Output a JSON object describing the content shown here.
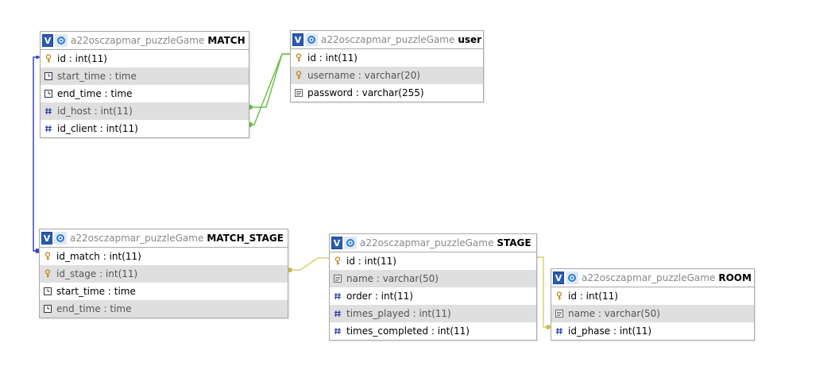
{
  "colors": {
    "header_toggle": "#2a5caa",
    "alt_row": "#dfdfdf",
    "link_blue": "#3b47c4",
    "link_green": "#6cc04a",
    "link_yellow": "#d8d070"
  },
  "tables": [
    {
      "db": "a22osczapmar_puzzleGame",
      "name": "MATCH",
      "toggle": "V",
      "columns": [
        {
          "text": "id : int(11)",
          "icon": "key-icon"
        },
        {
          "text": "start_time : time",
          "icon": "clock-icon"
        },
        {
          "text": "end_time : time",
          "icon": "clock-icon"
        },
        {
          "text": "id_host : int(11)",
          "icon": "hash-icon"
        },
        {
          "text": "id_client : int(11)",
          "icon": "hash-icon"
        }
      ]
    },
    {
      "db": "a22osczapmar_puzzleGame",
      "name": "user",
      "toggle": "V",
      "columns": [
        {
          "text": "id : int(11)",
          "icon": "key-icon"
        },
        {
          "text": "username : varchar(20)",
          "icon": "key-icon"
        },
        {
          "text": "password : varchar(255)",
          "icon": "text-icon"
        }
      ]
    },
    {
      "db": "a22osczapmar_puzzleGame",
      "name": "MATCH_STAGE",
      "toggle": "V",
      "columns": [
        {
          "text": "id_match : int(11)",
          "icon": "key-icon"
        },
        {
          "text": "id_stage : int(11)",
          "icon": "key-icon"
        },
        {
          "text": "start_time : time",
          "icon": "clock-icon"
        },
        {
          "text": "end_time : time",
          "icon": "clock-icon"
        }
      ]
    },
    {
      "db": "a22osczapmar_puzzleGame",
      "name": "STAGE",
      "toggle": "V",
      "columns": [
        {
          "text": "id : int(11)",
          "icon": "key-icon"
        },
        {
          "text": "name : varchar(50)",
          "icon": "text-icon"
        },
        {
          "text": "order : int(11)",
          "icon": "hash-icon"
        },
        {
          "text": "times_played : int(11)",
          "icon": "hash-icon"
        },
        {
          "text": "times_completed : int(11)",
          "icon": "hash-icon"
        }
      ]
    },
    {
      "db": "a22osczapmar_puzzleGame",
      "name": "ROOM",
      "toggle": "V",
      "columns": [
        {
          "text": "id : int(11)",
          "icon": "key-icon"
        },
        {
          "text": "name : varchar(50)",
          "icon": "text-icon"
        },
        {
          "text": "id_phase : int(11)",
          "icon": "hash-icon"
        }
      ]
    }
  ],
  "relations": [
    {
      "from": "MATCH.id",
      "to": "MATCH_STAGE.id_match",
      "color": "blue"
    },
    {
      "from": "MATCH.id_host",
      "to": "user.id",
      "color": "green"
    },
    {
      "from": "MATCH.id_client",
      "to": "user.id",
      "color": "green"
    },
    {
      "from": "MATCH_STAGE.id_stage",
      "to": "STAGE.id",
      "color": "yellow"
    },
    {
      "from": "STAGE.id",
      "to": "ROOM.id_phase",
      "color": "yellow"
    }
  ]
}
